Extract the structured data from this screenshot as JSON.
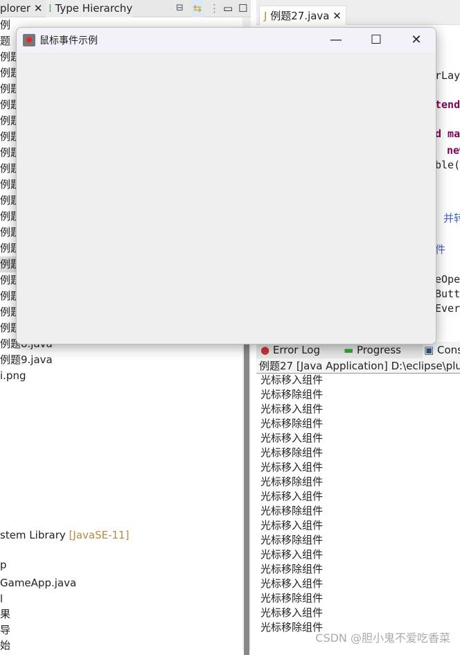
{
  "left_panel": {
    "tabs": [
      {
        "label": "plorer"
      },
      {
        "label": "Type Hierarchy"
      }
    ],
    "tree": [
      "例",
      "题",
      "例题",
      "例题",
      "例题",
      "例题",
      "例题",
      "例题",
      "例题",
      "例题",
      "例题",
      "例题",
      "例题",
      "例题",
      "例题",
      "例题",
      "例题",
      "例题",
      "例题",
      "例题7.java",
      "例题8.java",
      "例题9.java",
      "i.png"
    ],
    "library": "stem Library",
    "library_tag": "[JavaSE-11]",
    "tree_bottom": [
      "p",
      "GameApp.java",
      "l",
      "果",
      "导",
      "始"
    ]
  },
  "editor": {
    "tab_label": "例题27.java",
    "code_fragments": [
      "rLay",
      "tend",
      "d ma",
      "new",
      "ble(",
      "并转",
      "件",
      "eOpe",
      "Butt",
      "Ever"
    ]
  },
  "console": {
    "tabs": [
      "Error Log",
      "Progress",
      "Cons"
    ],
    "header": "例题27 [Java Application] D:\\eclipse\\plug",
    "lines": [
      "光标移入组件",
      "光标移除组件",
      "光标移入组件",
      "光标移除组件",
      "光标移入组件",
      "光标移除组件",
      "光标移入组件",
      "光标移除组件",
      "光标移入组件",
      "光标移除组件",
      "光标移入组件",
      "光标移除组件",
      "光标移入组件",
      "光标移除组件",
      "光标移入组件",
      "光标移除组件",
      "光标移入组件",
      "光标移除组件"
    ]
  },
  "window": {
    "title": "鼠标事件示例",
    "minimize": "—",
    "maximize": "☐",
    "close": "✕"
  },
  "watermark": "CSDN @胆小鬼不爱吃香菜"
}
